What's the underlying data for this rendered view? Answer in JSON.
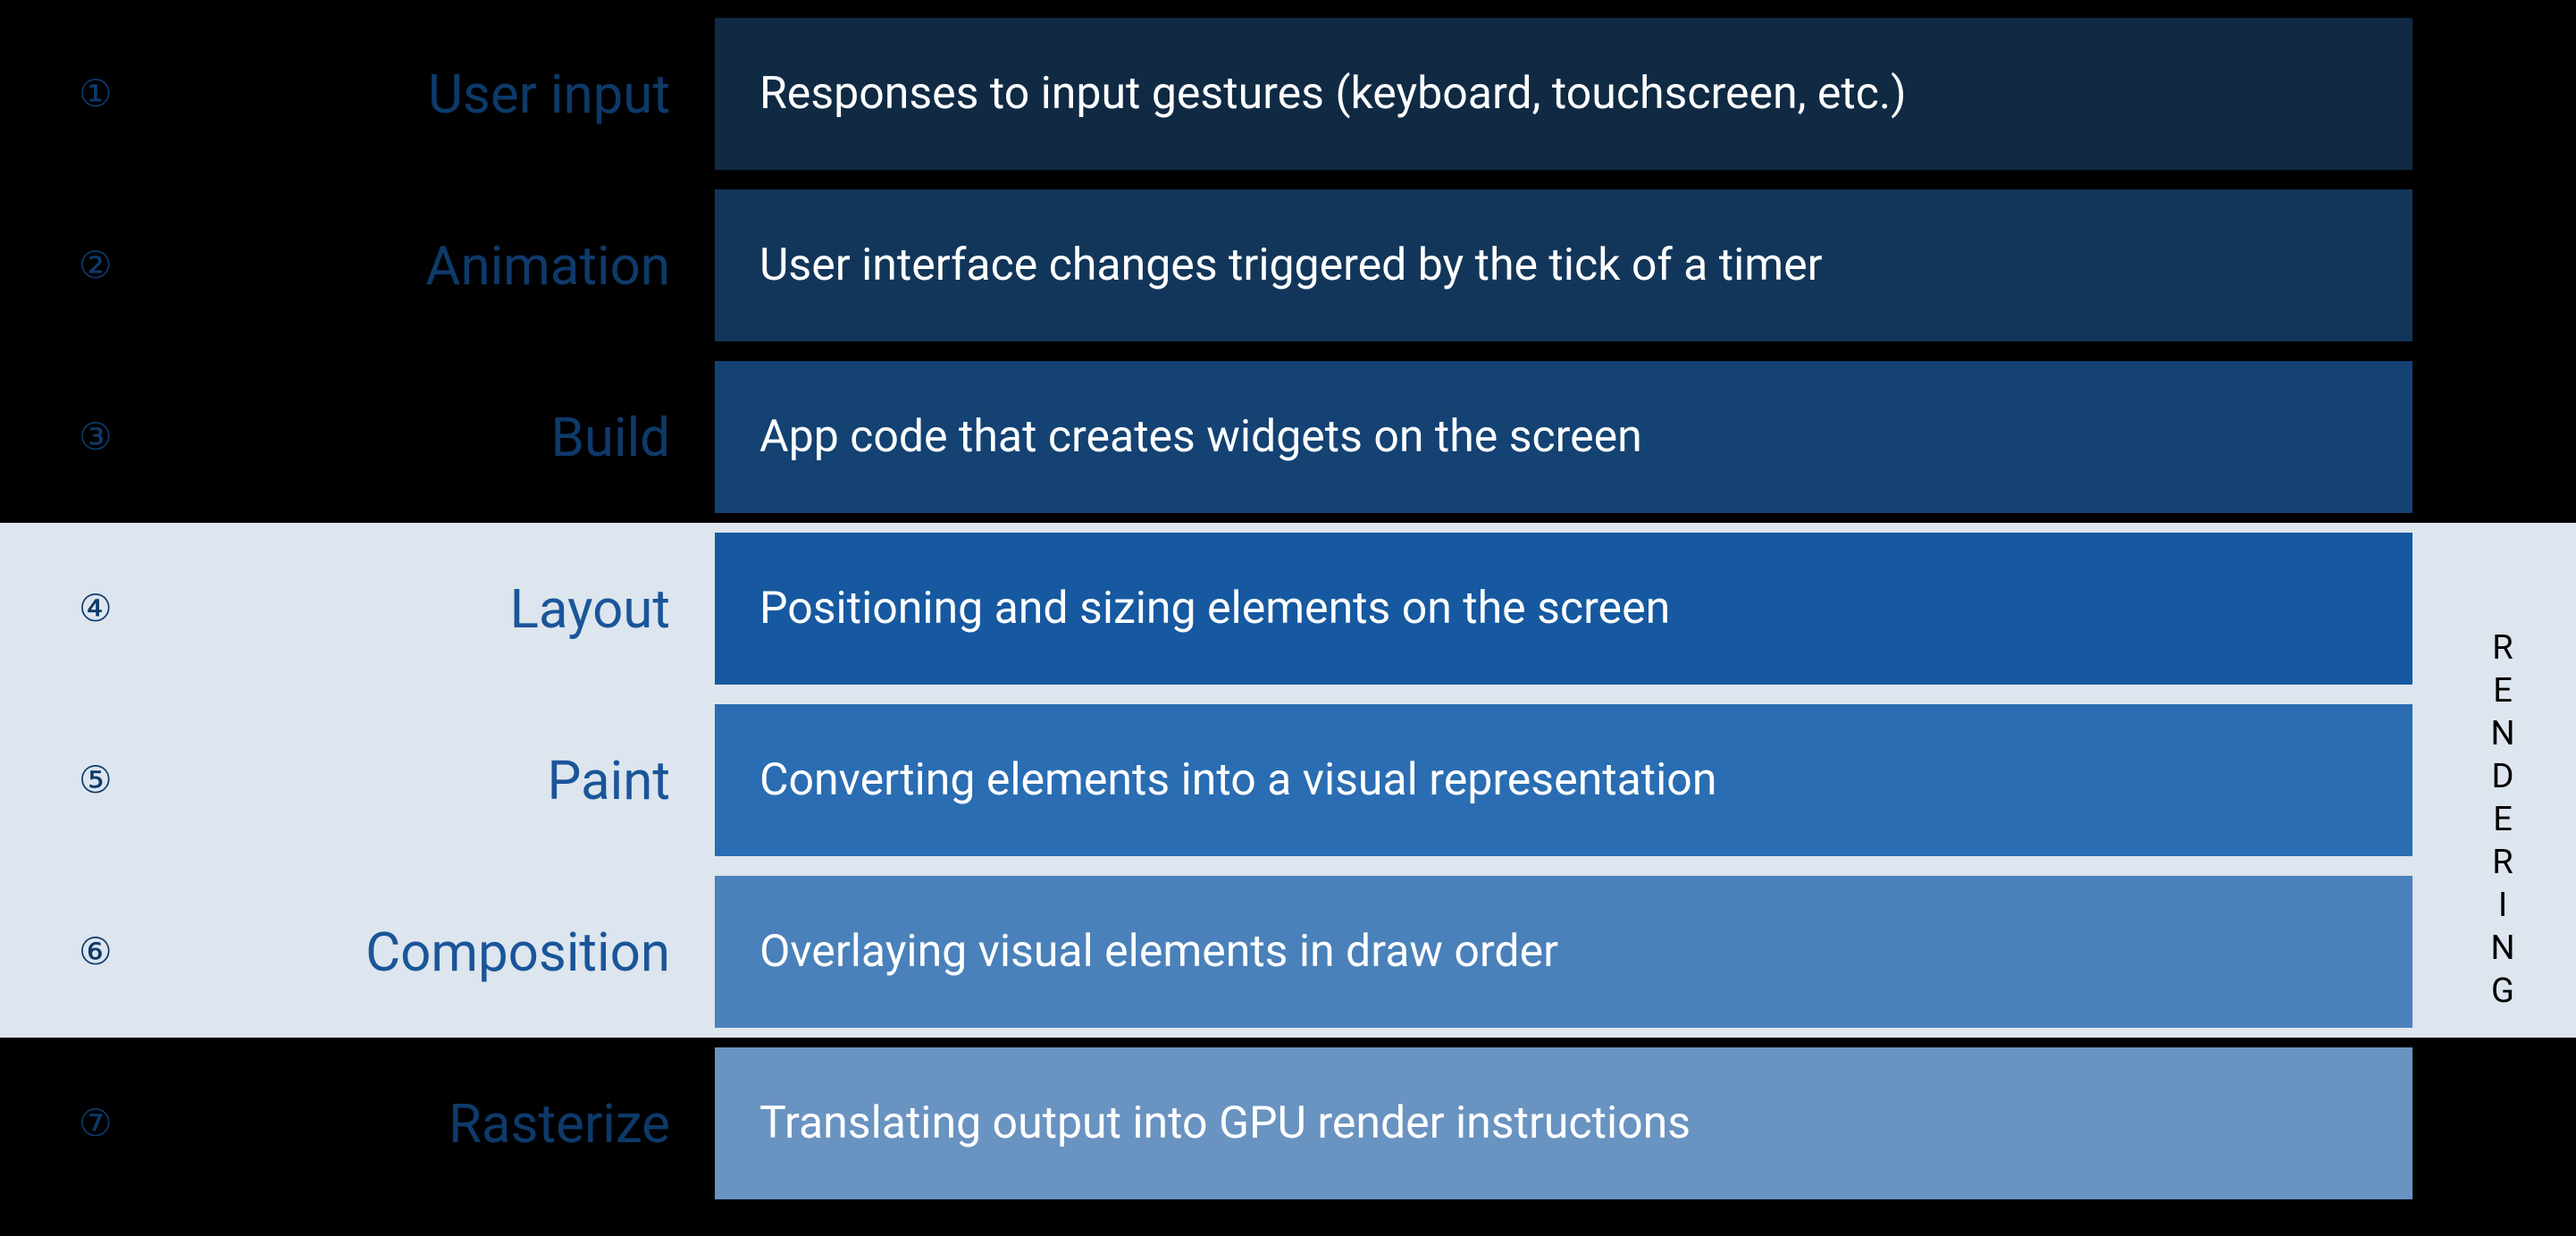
{
  "rendering_label": "RENDERING",
  "rows": [
    {
      "num": "①",
      "label": "User input",
      "desc": "Responses to input gestures (keyboard, touchscreen, etc.)",
      "bg": "#102a44",
      "rendering": false
    },
    {
      "num": "②",
      "label": "Animation",
      "desc": "User interface changes triggered by the tick of a timer",
      "bg": "#12365a",
      "rendering": false
    },
    {
      "num": "③",
      "label": "Build",
      "desc": "App code that creates widgets on the screen",
      "bg": "#134273",
      "rendering": false
    },
    {
      "num": "④",
      "label": "Layout",
      "desc": "Positioning and sizing elements on the screen",
      "bg": "#1659a0",
      "rendering": true
    },
    {
      "num": "⑤",
      "label": "Paint",
      "desc": "Converting elements into a visual representation",
      "bg": "#2a6db2",
      "rendering": true
    },
    {
      "num": "⑥",
      "label": "Composition",
      "desc": "Overlaying visual elements in draw order",
      "bg": "#4a81ba",
      "rendering": true
    },
    {
      "num": "⑦",
      "label": "Rasterize",
      "desc": "Translating output into GPU render instructions",
      "bg": "#6993c1",
      "rendering": false
    }
  ]
}
